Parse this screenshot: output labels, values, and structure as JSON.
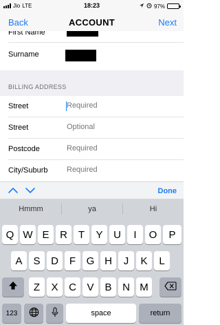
{
  "status_bar": {
    "carrier": "Jio",
    "network": "LTE",
    "time": "18:23",
    "battery": "97%"
  },
  "nav": {
    "back": "Back",
    "title": "ACCOUNT",
    "next": "Next"
  },
  "form": {
    "first_name_label": "First Name",
    "surname_label": "Surname",
    "billing_header": "BILLING ADDRESS",
    "fields": [
      {
        "label": "Street",
        "placeholder": "Required"
      },
      {
        "label": "Street",
        "placeholder": "Optional"
      },
      {
        "label": "Postcode",
        "placeholder": "Required"
      },
      {
        "label": "City/Suburb",
        "placeholder": "Required"
      }
    ]
  },
  "accessory": {
    "done": "Done"
  },
  "keyboard": {
    "suggestions": [
      "Hmmm",
      "ya",
      "Hi"
    ],
    "row1": [
      "Q",
      "W",
      "E",
      "R",
      "T",
      "Y",
      "U",
      "I",
      "O",
      "P"
    ],
    "row2": [
      "A",
      "S",
      "D",
      "F",
      "G",
      "H",
      "J",
      "K",
      "L"
    ],
    "row3": [
      "Z",
      "X",
      "C",
      "V",
      "B",
      "N",
      "M"
    ],
    "numbers_key": "123",
    "space_key": "space",
    "return_key": "return"
  },
  "colors": {
    "accent": "#1a7cf7",
    "placeholder": "#b9b9be",
    "section_bg": "#efeff4",
    "keyboard_bg": "#d1d4d9"
  }
}
